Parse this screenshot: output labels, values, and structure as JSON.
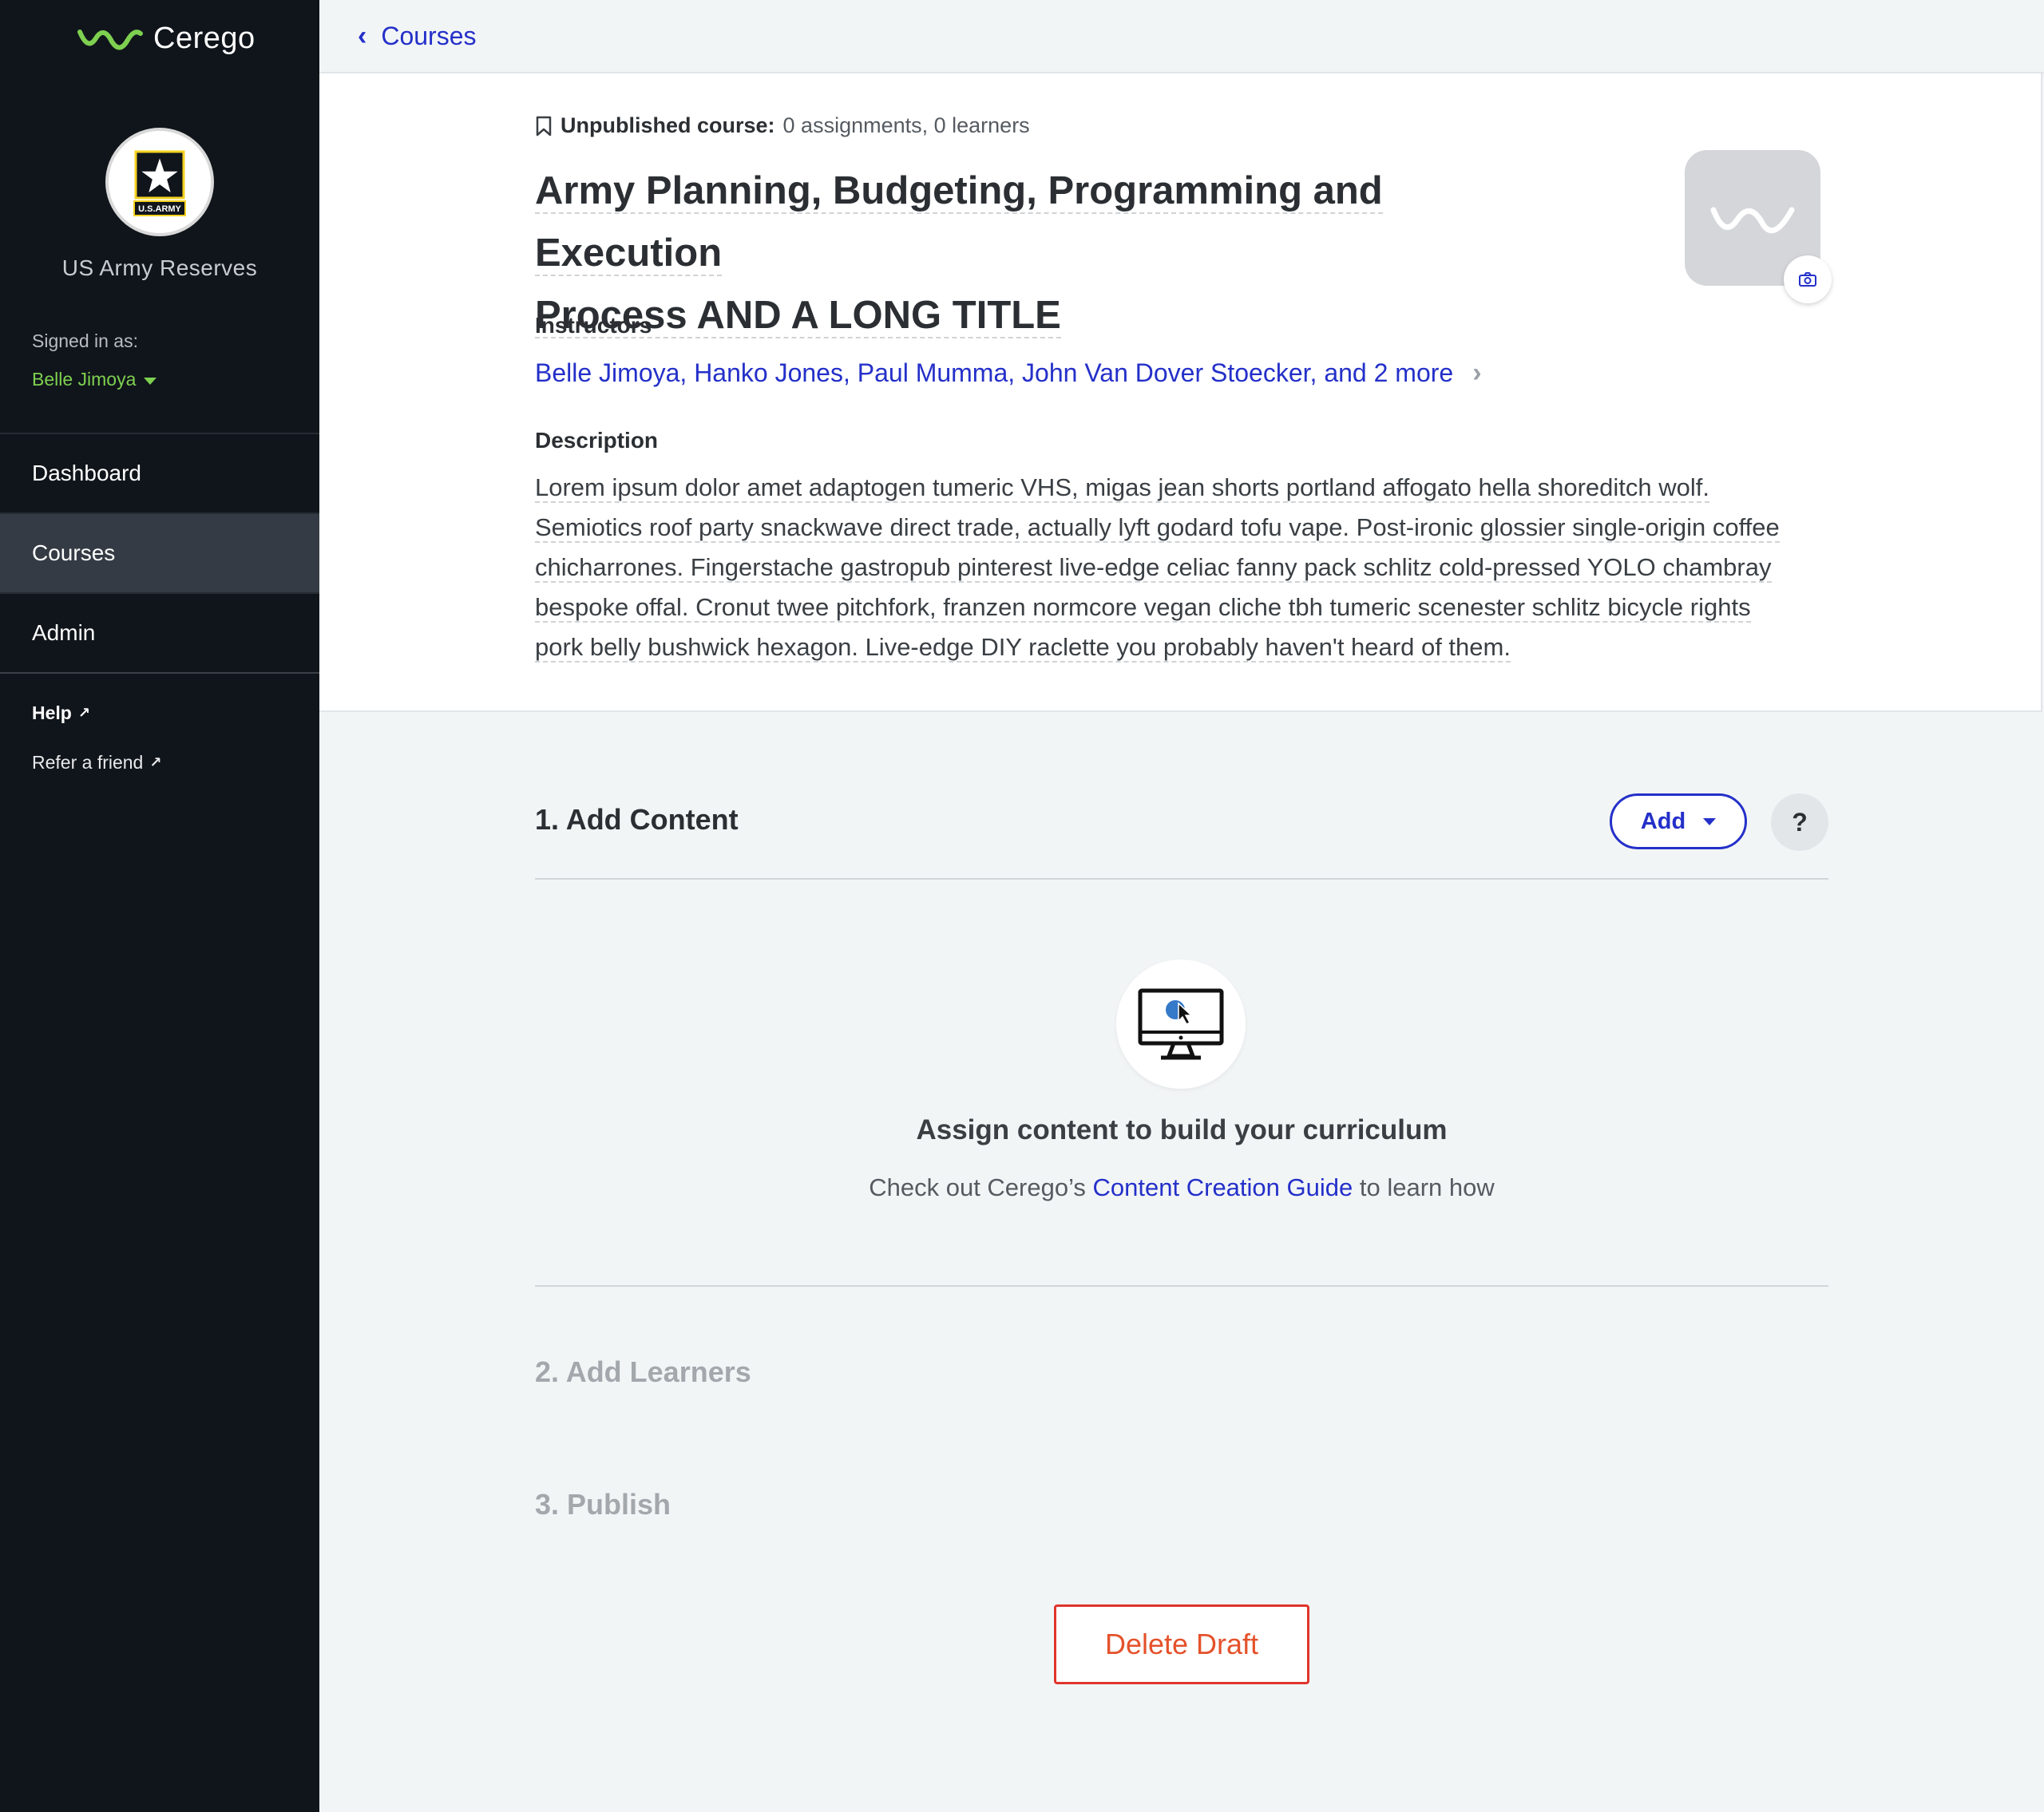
{
  "sidebar": {
    "logo_text": "Cerego",
    "org_name": "US Army Reserves",
    "org_badge_text": "U.S.ARMY",
    "signed_in_label": "Signed in as:",
    "user_name": "Belle Jimoya",
    "nav": [
      {
        "label": "Dashboard",
        "active": false
      },
      {
        "label": "Courses",
        "active": true
      },
      {
        "label": "Admin",
        "active": false
      }
    ],
    "help_label": "Help",
    "refer_label": "Refer a friend",
    "colors": {
      "background": "#10151b",
      "active": "#343b44",
      "user": "#7ed050"
    }
  },
  "topbar": {
    "back_label": "Courses"
  },
  "course": {
    "status_bold": "Unpublished course:",
    "status_rest": "0 assignments, 0 learners",
    "title_line1": "Army Planning, Budgeting, Programming and Execution",
    "title_line2": "Process AND A LONG TITLE",
    "instructors_label": "Instructors",
    "instructors": "Belle Jimoya, Hanko Jones, Paul Mumma, John Van Dover Stoecker, and 2 more",
    "description_label": "Description",
    "description_lines": [
      "Lorem ipsum dolor amet adaptogen tumeric VHS, migas jean shorts portland affogato hella shoreditch wolf.",
      "Semiotics roof party snackwave direct trade, actually lyft godard tofu vape. Post-ironic glossier single-origin coffee",
      "chicharrones. Fingerstache gastropub pinterest live-edge celiac fanny pack schlitz cold-pressed YOLO chambray",
      "bespoke offal. Cronut twee pitchfork, franzen normcore vegan cliche tbh tumeric scenester schlitz bicycle rights",
      "pork belly bushwick hexagon. Live-edge DIY raclette you probably haven't heard of them."
    ]
  },
  "steps": {
    "add_content": "1. Add Content",
    "add_button": "Add",
    "help_button": "?",
    "empty_title": "Assign content to build your curriculum",
    "empty_sub_prefix": "Check out Cerego’s ",
    "empty_sub_link": "Content Creation Guide",
    "empty_sub_suffix": " to learn how",
    "add_learners": "2. Add Learners",
    "publish": "3. Publish",
    "delete_button": "Delete Draft"
  },
  "icons": [
    "cerego-logo-icon",
    "army-star-icon",
    "caret-down-icon",
    "external-link-icon",
    "chevron-left-icon",
    "bookmark-icon",
    "camera-icon",
    "chevron-right-icon",
    "computer-cursor-icon"
  ],
  "colors": {
    "link": "#2430c9",
    "danger": "#e0352b",
    "muted_step": "#a3a8ad"
  }
}
